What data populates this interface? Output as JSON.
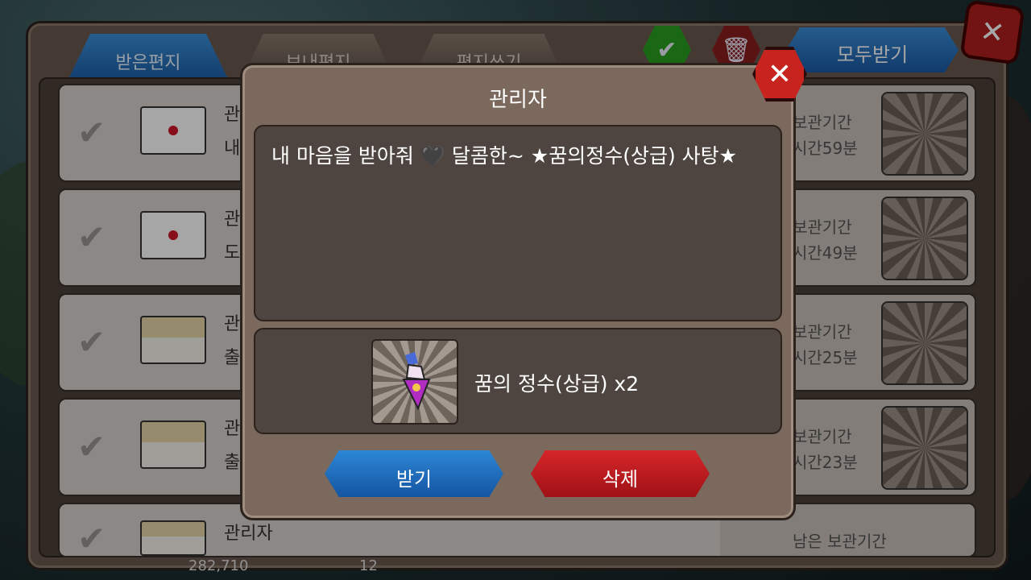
{
  "tabs": [
    {
      "label": "받은편지",
      "active": true
    },
    {
      "label": "보내편지",
      "active": false
    },
    {
      "label": "편지쓰기",
      "active": false
    }
  ],
  "toolbar": {
    "receive_all": "모두받기"
  },
  "rows": [
    {
      "sender": "관",
      "sub": "내",
      "rt1": "보관기간",
      "rt2": "시간59분",
      "opened": false
    },
    {
      "sender": "관",
      "sub": "도",
      "rt1": "보관기간",
      "rt2": "시간49분",
      "opened": false
    },
    {
      "sender": "관",
      "sub": "출",
      "rt1": "보관기간",
      "rt2": "시간25분",
      "opened": true
    },
    {
      "sender": "관",
      "sub": "출",
      "rt1": "보관기간",
      "rt2": "시간23분",
      "opened": true
    },
    {
      "sender": "관리자",
      "sub": "",
      "rt1": "남은 보관기간",
      "rt2": "",
      "opened": true
    }
  ],
  "dialog": {
    "title": "관리자",
    "message": "내 마음을 받아줘 🖤 달콤한~ ★꿈의정수(상급) 사탕★",
    "reward_label": "꿈의 정수(상급) x2",
    "receive": "받기",
    "delete": "삭제"
  },
  "footer": {
    "gold": "282,710",
    "gems": "12"
  },
  "colors": {
    "accent_blue": "#1c5fa8",
    "danger_red": "#c8241f",
    "panel": "#7a695c"
  },
  "icons": {
    "check": "check-icon",
    "envelope": "envelope-icon",
    "close": "close-icon",
    "trash": "trash-icon",
    "potion": "potion-icon"
  }
}
